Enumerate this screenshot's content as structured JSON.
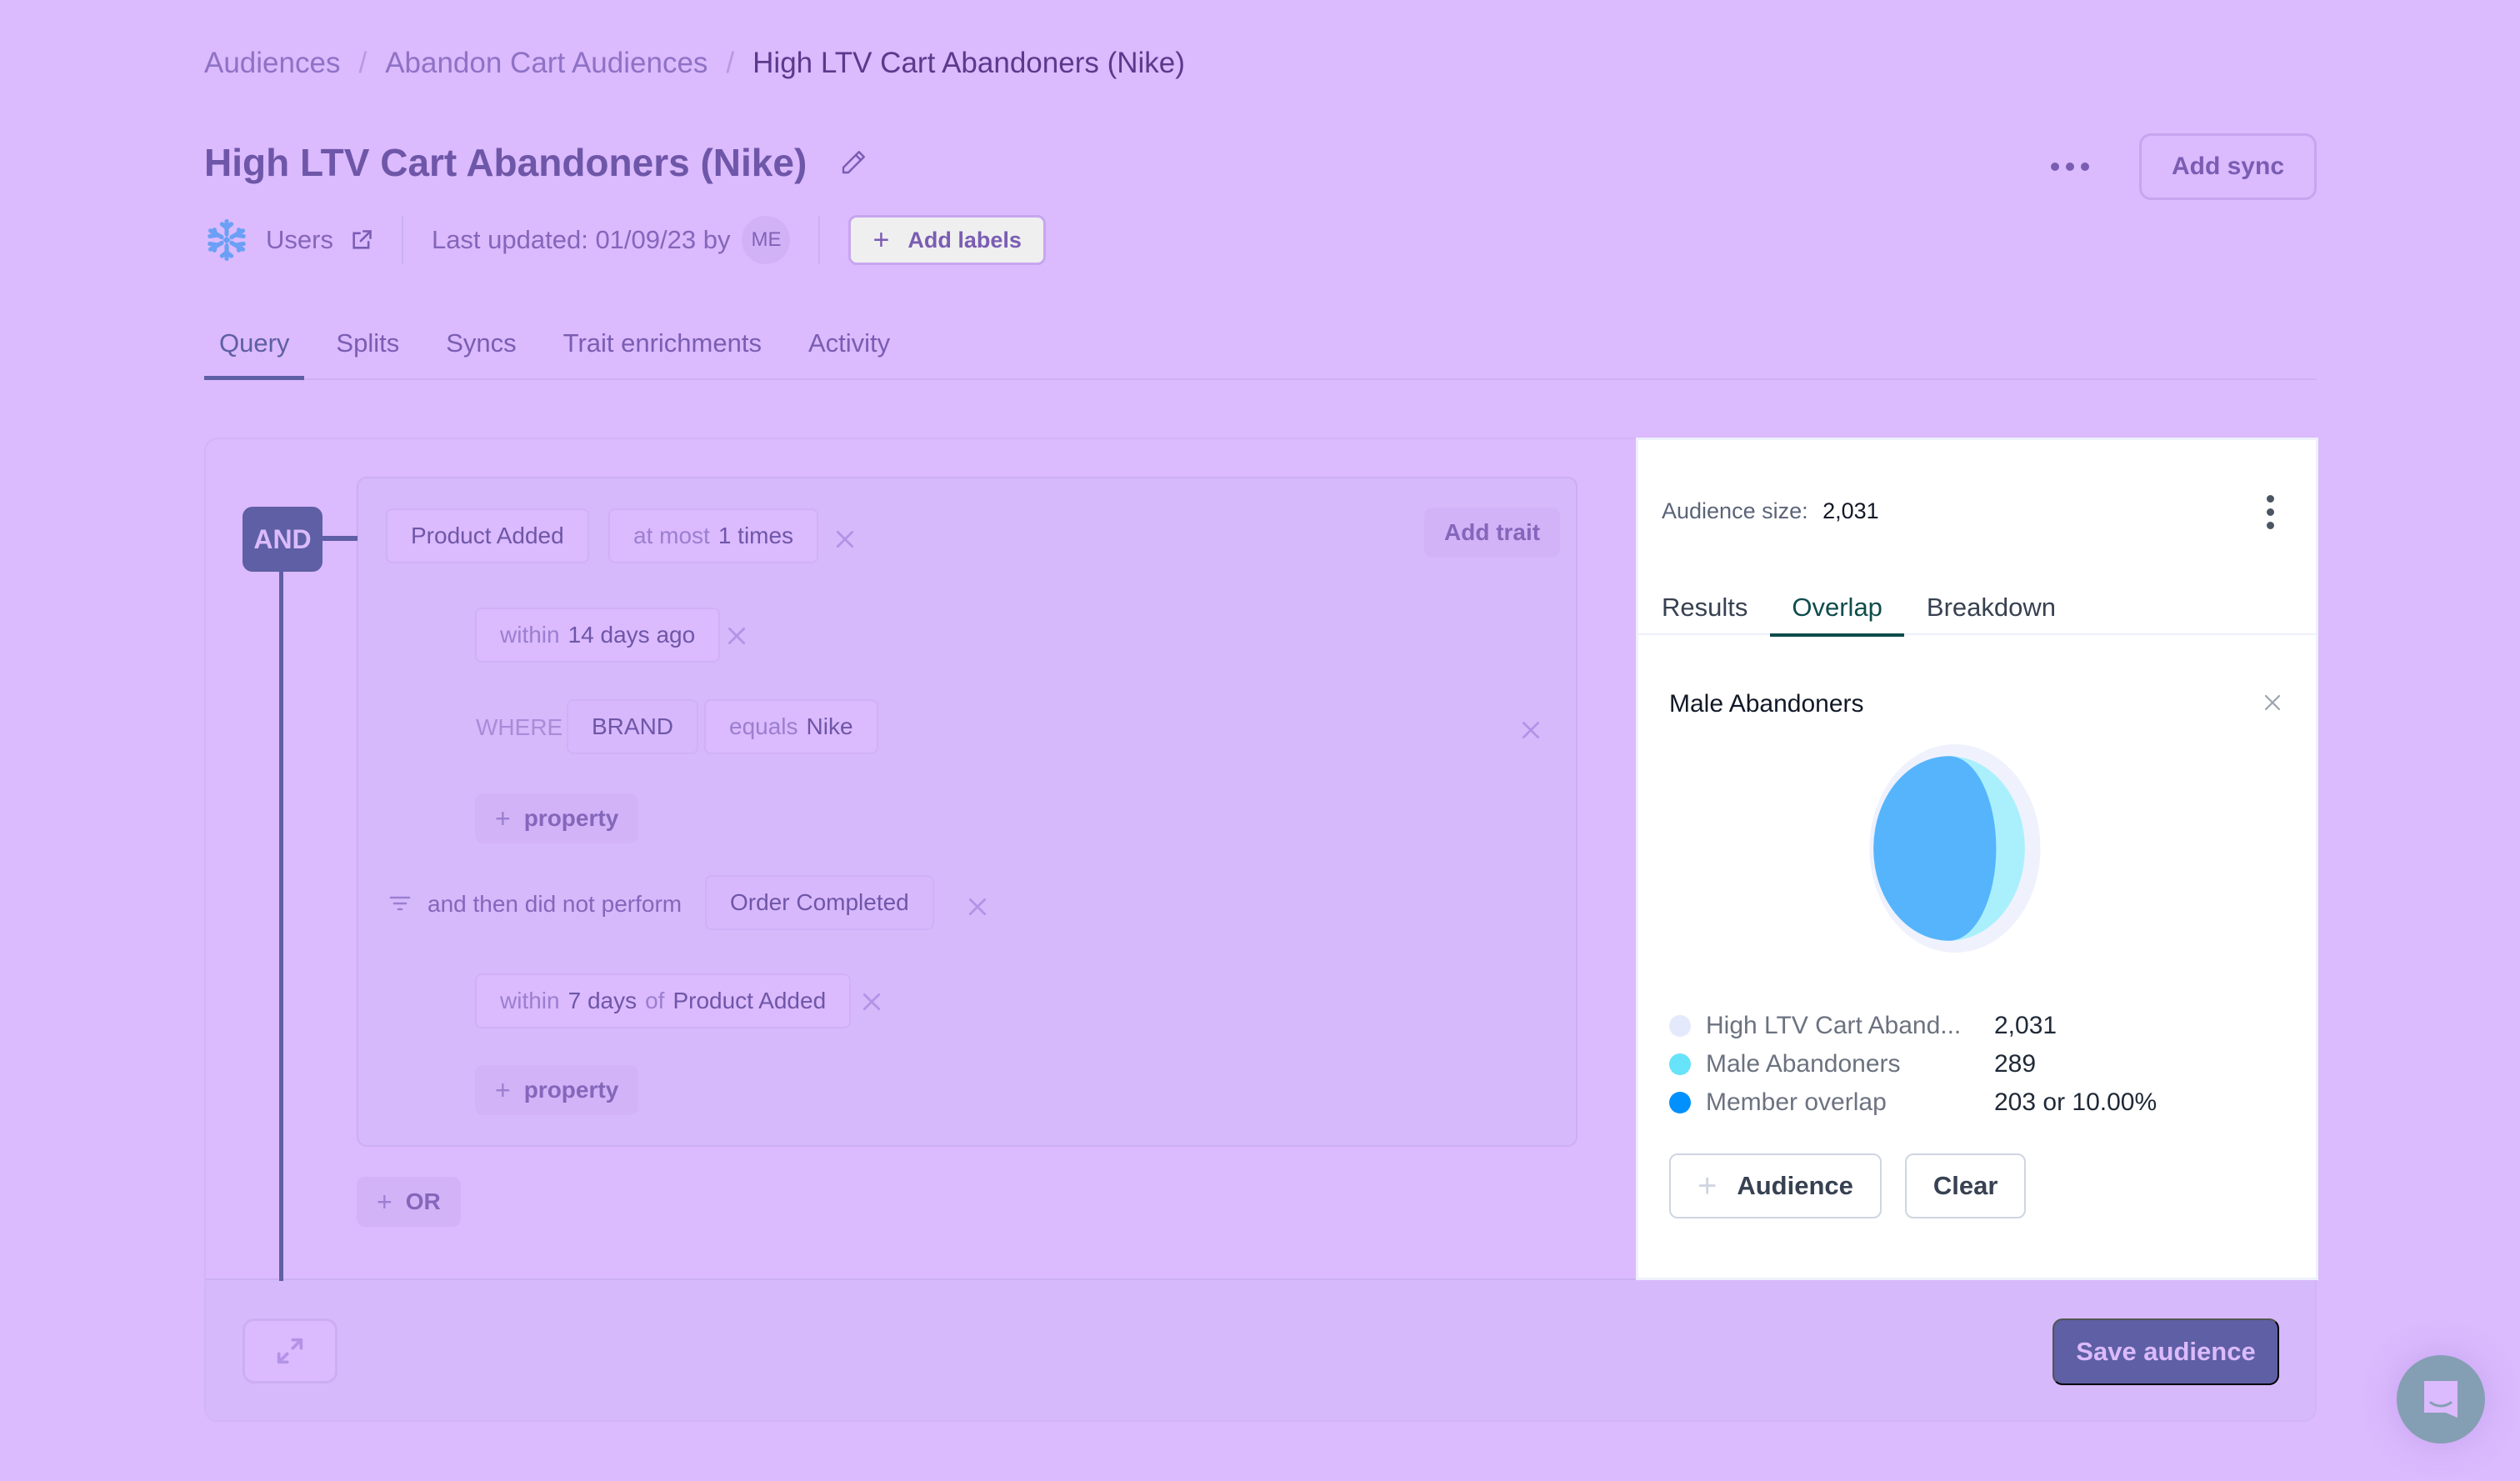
{
  "breadcrumb": {
    "items": [
      "Audiences",
      "Abandon Cart Audiences"
    ],
    "separator": "/",
    "current": "High LTV Cart Abandoners (Nike)"
  },
  "header": {
    "title": "High LTV Cart Abandoners (Nike)",
    "edit_icon": "pencil-icon",
    "more_icon": "more-horizontal-icon",
    "add_sync_label": "Add sync"
  },
  "meta": {
    "source_icon": "snowflake-icon",
    "source_label": "Users",
    "external_icon": "external-link-icon",
    "last_updated": "Last updated: 01/09/23 by",
    "avatar_initials": "ME",
    "add_labels_label": "Add labels",
    "add_labels_icon": "plus-icon"
  },
  "tabs": [
    {
      "label": "Query",
      "active": true
    },
    {
      "label": "Splits",
      "active": false
    },
    {
      "label": "Syncs",
      "active": false
    },
    {
      "label": "Trait enrichments",
      "active": false
    },
    {
      "label": "Activity",
      "active": false
    }
  ],
  "query": {
    "operator": "AND",
    "add_trait_label": "Add trait",
    "event": {
      "name": "Product Added",
      "frequency_prefix": "at most",
      "frequency_value": "1 times",
      "window_prefix": "within",
      "window_value": "14 days ago",
      "where_label": "WHERE",
      "property": "BRAND",
      "operator_label": "equals",
      "property_value": "Nike",
      "add_property_label": "property"
    },
    "followup": {
      "filter_icon": "filter-icon",
      "label": "and then did not perform",
      "event_name": "Order Completed",
      "window_prefix": "within",
      "window_value": "7 days",
      "window_of": "of",
      "window_ref": "Product Added",
      "add_property_label": "property"
    },
    "or_label": "OR"
  },
  "footer": {
    "expand_icon": "expand-arrows-icon",
    "save_label": "Save audience",
    "chat_icon": "chat-support-icon"
  },
  "panel": {
    "audience_size_label": "Audience size:",
    "audience_size_value": "2,031",
    "menu_icon": "more-vertical-icon",
    "tabs": [
      {
        "label": "Results",
        "active": false
      },
      {
        "label": "Overlap",
        "active": true
      },
      {
        "label": "Breakdown",
        "active": false
      }
    ],
    "overlap_audience": "Male Abandoners",
    "close_icon": "close-icon",
    "add_audience_label": "Audience",
    "clear_label": "Clear"
  },
  "chart_data": {
    "type": "venn",
    "title": "Male Abandoners",
    "sets": [
      {
        "name": "High LTV Cart Aband...",
        "full_name": "High LTV Cart Abandoners (Nike)",
        "size": 2031,
        "display": "2,031",
        "color": "#e4e9fb"
      },
      {
        "name": "Male Abandoners",
        "size": 289,
        "display": "289",
        "color": "#67e3f9"
      }
    ],
    "overlap": {
      "name": "Member overlap",
      "size": 203,
      "percent": 10.0,
      "display": "203 or 10.00%",
      "color": "#0091ff"
    },
    "legend_position": "bottom"
  }
}
